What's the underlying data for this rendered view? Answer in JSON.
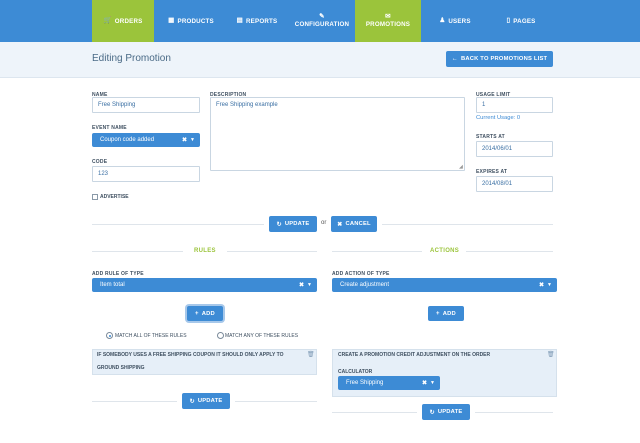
{
  "nav": {
    "items": [
      {
        "label": "Orders",
        "icon": "cart-icon",
        "glyph": "🛒"
      },
      {
        "label": "Products",
        "icon": "grid-icon",
        "glyph": "▦"
      },
      {
        "label": "Reports",
        "icon": "file-icon",
        "glyph": "▤"
      },
      {
        "label": "Configuration",
        "icon": "wrench-icon",
        "glyph": "✎"
      },
      {
        "label": "Promotions",
        "icon": "megaphone-icon",
        "glyph": "✉"
      },
      {
        "label": "Users",
        "icon": "user-icon",
        "glyph": "♟"
      },
      {
        "label": "Pages",
        "icon": "page-icon",
        "glyph": "▯"
      }
    ],
    "active": "Promotions"
  },
  "header": {
    "title": "Editing Promotion",
    "back_button": "Back to Promotions List"
  },
  "form": {
    "name_label": "Name",
    "name_value": "Free Shipping",
    "event_label": "Event Name",
    "event_value": "Coupon code added",
    "code_label": "Code",
    "code_value": "123",
    "advertise_label": "Advertise",
    "description_label": "Description",
    "description_value": "Free Shipping example",
    "usage_limit_label": "Usage Limit",
    "usage_limit_value": "1",
    "current_usage": "Current Usage: 0",
    "starts_at_label": "Starts At",
    "starts_at_value": "2014/06/01",
    "expires_at_label": "Expires At",
    "expires_at_value": "2014/08/01"
  },
  "actions_bar": {
    "update": "Update",
    "or": "or",
    "cancel": "Cancel"
  },
  "rules": {
    "title": "Rules",
    "add_label": "Add Rule of Type",
    "select_value": "Item total",
    "add_button": "Add",
    "match_all": "Match all of these rules",
    "match_any": "Match any of these rules",
    "rule_text": "If somebody uses a free shipping coupon it should only apply to ground shipping",
    "update_button": "Update"
  },
  "actions": {
    "title": "Actions",
    "add_label": "Add Action of Type",
    "select_value": "Create adjustment",
    "add_button": "Add",
    "action_text": "Create a promotion credit adjustment on the order",
    "calculator_label": "Calculator",
    "calculator_value": "Free Shipping",
    "update_button": "Update"
  },
  "colors": {
    "primary": "#3d8bd5",
    "active_tab": "#9bc43b",
    "section_title": "#9bc43b"
  }
}
